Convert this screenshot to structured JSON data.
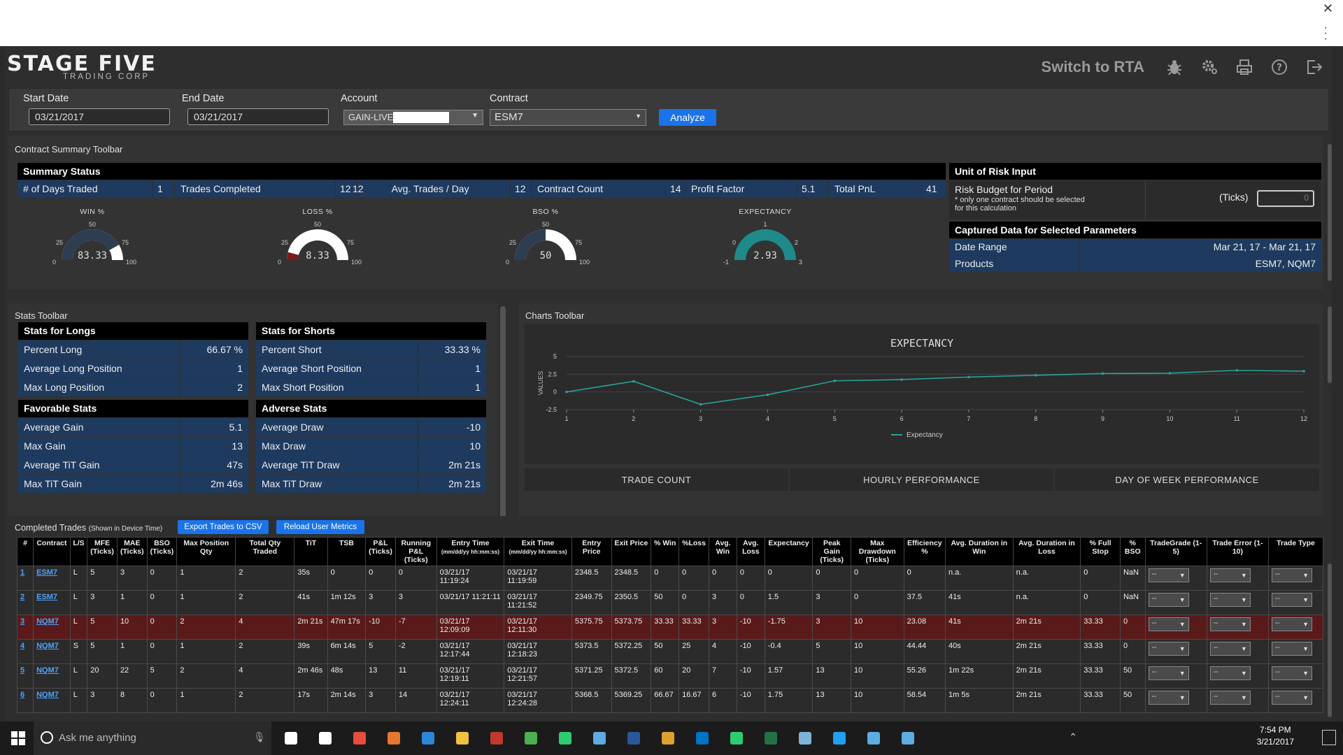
{
  "app": {
    "logo_main": "STAGE FIVE",
    "logo_sub": "TRADING CORP",
    "switch_label": "Switch to RTA",
    "header_icons": [
      "bug-icon",
      "gear-icon",
      "print-icon",
      "help-icon",
      "logout-icon"
    ]
  },
  "filters": {
    "start_label": "Start Date",
    "start_value": "03/21/2017",
    "end_label": "End Date",
    "end_value": "03/21/2017",
    "account_label": "Account",
    "account_value": "GAIN-LIVE",
    "contract_label": "Contract",
    "contract_value": "ESM7",
    "analyze_label": "Analyze"
  },
  "contract_summary": {
    "toolbar_title": "Contract Summary Toolbar",
    "summary_title": "Summary Status",
    "metrics": [
      {
        "label": "# of Days Traded",
        "value": "1"
      },
      {
        "label": "Trades Completed",
        "value": "12"
      },
      {
        "label": "Avg. Trades / Day",
        "value": "12"
      },
      {
        "label": "Contract Count",
        "value": "14"
      },
      {
        "label": "Profit Factor",
        "value": "5.1"
      },
      {
        "label": "Total PnL",
        "value": "41"
      }
    ],
    "gauges": [
      {
        "title": "WIN %",
        "value_text": "83.33",
        "value": 83.33,
        "ticks": [
          "0",
          "25",
          "50",
          "75",
          "100"
        ]
      },
      {
        "title": "LOSS %",
        "value_text": "8.33",
        "value": 8.33,
        "ticks": [
          "0",
          "25",
          "50",
          "75",
          "100"
        ]
      },
      {
        "title": "BSO %",
        "value_text": "50",
        "value": 50,
        "ticks": [
          "0",
          "25",
          "50",
          "75",
          "100"
        ]
      },
      {
        "title": "EXPECTANCY",
        "value_text": "2.93",
        "value": 2.93,
        "ticks": [
          "-1",
          "0",
          "1",
          "2",
          "3"
        ]
      }
    ],
    "unit_risk_title": "Unit of Risk Input",
    "risk_budget_label": "Risk Budget for Period",
    "risk_note": "* only one contract should be selected for this calculation",
    "risk_unit": "(Ticks)",
    "risk_value": "0",
    "captured_title": "Captured Data for Selected Parameters",
    "date_range_label": "Date Range",
    "date_range_value": "Mar 21, 17 - Mar 21, 17",
    "products_label": "Products",
    "products_value": "ESM7, NQM7"
  },
  "stats": {
    "toolbar_title": "Stats Toolbar",
    "longs_title": "Stats for Longs",
    "longs": [
      {
        "label": "Percent Long",
        "value": "66.67 %"
      },
      {
        "label": "Average Long Position",
        "value": "1"
      },
      {
        "label": "Max Long Position",
        "value": "2"
      }
    ],
    "shorts_title": "Stats for Shorts",
    "shorts": [
      {
        "label": "Percent Short",
        "value": "33.33 %"
      },
      {
        "label": "Average Short Position",
        "value": "1"
      },
      {
        "label": "Max Short Position",
        "value": "1"
      }
    ],
    "favorable_title": "Favorable Stats",
    "favorable": [
      {
        "label": "Average Gain",
        "value": "5.1"
      },
      {
        "label": "Max Gain",
        "value": "13"
      },
      {
        "label": "Average TiT Gain",
        "value": "47s"
      },
      {
        "label": "Max TiT Gain",
        "value": "2m 46s"
      }
    ],
    "adverse_title": "Adverse Stats",
    "adverse": [
      {
        "label": "Average Draw",
        "value": "-10"
      },
      {
        "label": "Max Draw",
        "value": "10"
      },
      {
        "label": "Average TiT Draw",
        "value": "2m 21s"
      },
      {
        "label": "Max TiT Draw",
        "value": "2m 21s"
      }
    ]
  },
  "charts": {
    "toolbar_title": "Charts Toolbar",
    "tabs": [
      "TRADE COUNT",
      "HOURLY PERFORMANCE",
      "DAY OF WEEK PERFORMANCE"
    ]
  },
  "chart_data": {
    "type": "line",
    "title": "EXPECTANCY",
    "ylabel": "VALUES",
    "xlabel": "",
    "x": [
      1,
      2,
      3,
      4,
      5,
      6,
      7,
      8,
      9,
      10,
      11,
      12
    ],
    "series": [
      {
        "name": "Expectancy",
        "values": [
          0,
          1.5,
          -1.75,
          -0.4,
          1.57,
          1.75,
          2.1,
          2.35,
          2.6,
          2.65,
          3.05,
          2.93
        ]
      }
    ],
    "ylim": [
      -2.5,
      5
    ],
    "yticks": [
      "5",
      "2.5",
      "0",
      "-2.5"
    ],
    "grid": true,
    "legend": "bottom",
    "color": "#2aa198"
  },
  "trades": {
    "title": "Completed Trades",
    "subtitle": "(Shown in Device Time)",
    "export_label": "Export Trades to CSV",
    "reload_label": "Reload User Metrics",
    "columns": [
      "#",
      "Contract",
      "L/S",
      "MFE (Ticks)",
      "MAE (Ticks)",
      "BSO (Ticks)",
      "Max Position Qty",
      "Total Qty Traded",
      "TiT",
      "TSB",
      "P&L (Ticks)",
      "Running P&L (Ticks)",
      "Entry Time",
      "Exit Time",
      "Entry Price",
      "Exit Price",
      "% Win",
      "%Loss",
      "Avg. Win",
      "Avg. Loss",
      "Expectancy",
      "Peak Gain (Ticks)",
      "Max Drawdown (Ticks)",
      "Efficiency %",
      "Avg. Duration in Win",
      "Avg. Duration in Loss",
      "% Full Stop",
      "% BSO",
      "TradeGrade (1-5)",
      "Trade Error (1-10)",
      "Trade Type"
    ],
    "time_format": "(mm/dd/yy hh:mm:ss)",
    "dropdown_value": "--",
    "rows": [
      {
        "n": "1",
        "contract": "ESM7",
        "ls": "L",
        "mfe": "5",
        "mae": "3",
        "bso": "0",
        "maxpos": "1",
        "totqty": "2",
        "tit": "35s",
        "tsb": "0",
        "pl": "0",
        "rpl": "0",
        "entry": "03/21/17 11:19:24",
        "exit": "03/21/17 11:19:59",
        "eprice": "2348.5",
        "xprice": "2348.5",
        "win": "0",
        "loss": "0",
        "avgwin": "0",
        "avgloss": "0",
        "exp": "0",
        "peak": "0",
        "mdd": "0",
        "eff": "0",
        "durwin": "n.a.",
        "durloss": "n.a.",
        "fullstop": "0",
        "pbso": "NaN",
        "highlight": false
      },
      {
        "n": "2",
        "contract": "ESM7",
        "ls": "L",
        "mfe": "3",
        "mae": "1",
        "bso": "0",
        "maxpos": "1",
        "totqty": "2",
        "tit": "41s",
        "tsb": "1m 12s",
        "pl": "3",
        "rpl": "3",
        "entry": "03/21/17 11:21:11",
        "exit": "03/21/17 11:21:52",
        "eprice": "2349.75",
        "xprice": "2350.5",
        "win": "50",
        "loss": "0",
        "avgwin": "3",
        "avgloss": "0",
        "exp": "1.5",
        "peak": "3",
        "mdd": "0",
        "eff": "37.5",
        "durwin": "41s",
        "durloss": "n.a.",
        "fullstop": "0",
        "pbso": "NaN",
        "highlight": false
      },
      {
        "n": "3",
        "contract": "NQM7",
        "ls": "L",
        "mfe": "5",
        "mae": "10",
        "bso": "0",
        "maxpos": "2",
        "totqty": "4",
        "tit": "2m 21s",
        "tsb": "47m 17s",
        "pl": "-10",
        "rpl": "-7",
        "entry": "03/21/17 12:09:09",
        "exit": "03/21/17 12:11:30",
        "eprice": "5375.75",
        "xprice": "5373.75",
        "win": "33.33",
        "loss": "33.33",
        "avgwin": "3",
        "avgloss": "-10",
        "exp": "-1.75",
        "peak": "3",
        "mdd": "10",
        "eff": "23.08",
        "durwin": "41s",
        "durloss": "2m 21s",
        "fullstop": "33.33",
        "pbso": "0",
        "highlight": true
      },
      {
        "n": "4",
        "contract": "NQM7",
        "ls": "S",
        "mfe": "5",
        "mae": "1",
        "bso": "0",
        "maxpos": "1",
        "totqty": "2",
        "tit": "39s",
        "tsb": "6m 14s",
        "pl": "5",
        "rpl": "-2",
        "entry": "03/21/17 12:17:44",
        "exit": "03/21/17 12:18:23",
        "eprice": "5373.5",
        "xprice": "5372.25",
        "win": "50",
        "loss": "25",
        "avgwin": "4",
        "avgloss": "-10",
        "exp": "-0.4",
        "peak": "5",
        "mdd": "10",
        "eff": "44.44",
        "durwin": "40s",
        "durloss": "2m 21s",
        "fullstop": "33.33",
        "pbso": "0",
        "highlight": false
      },
      {
        "n": "5",
        "contract": "NQM7",
        "ls": "L",
        "mfe": "20",
        "mae": "22",
        "bso": "5",
        "maxpos": "2",
        "totqty": "4",
        "tit": "2m 46s",
        "tsb": "48s",
        "pl": "13",
        "rpl": "11",
        "entry": "03/21/17 12:19:11",
        "exit": "03/21/17 12:21:57",
        "eprice": "5371.25",
        "xprice": "5372.5",
        "win": "60",
        "loss": "20",
        "avgwin": "7",
        "avgloss": "-10",
        "exp": "1.57",
        "peak": "13",
        "mdd": "10",
        "eff": "55.26",
        "durwin": "1m 22s",
        "durloss": "2m 21s",
        "fullstop": "33.33",
        "pbso": "50",
        "highlight": false
      },
      {
        "n": "6",
        "contract": "NQM7",
        "ls": "L",
        "mfe": "3",
        "mae": "8",
        "bso": "0",
        "maxpos": "1",
        "totqty": "2",
        "tit": "17s",
        "tsb": "2m 14s",
        "pl": "3",
        "rpl": "14",
        "entry": "03/21/17 12:24:11",
        "exit": "03/21/17 12:24:28",
        "eprice": "5368.5",
        "xprice": "5369.25",
        "win": "66.67",
        "loss": "16.67",
        "avgwin": "6",
        "avgloss": "-10",
        "exp": "1.75",
        "peak": "13",
        "mdd": "10",
        "eff": "58.54",
        "durwin": "1m 5s",
        "durloss": "2m 21s",
        "fullstop": "33.33",
        "pbso": "50",
        "highlight": false
      }
    ]
  },
  "taskbar": {
    "search_placeholder": "Ask me anything",
    "time": "7:54 PM",
    "date": "3/21/2017"
  }
}
